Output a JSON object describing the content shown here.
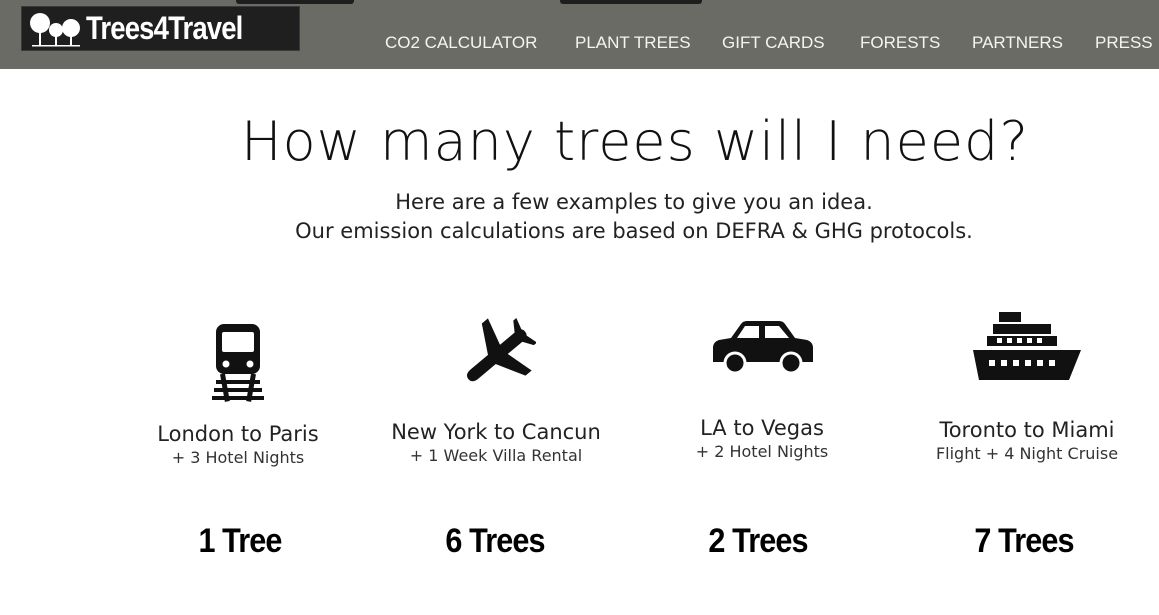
{
  "header": {
    "logo_text": "Trees4Travel",
    "nav": [
      {
        "label": "CO2 CALCULATOR"
      },
      {
        "label": "PLANT TREES"
      },
      {
        "label": "GIFT CARDS"
      },
      {
        "label": "FORESTS"
      },
      {
        "label": "PARTNERS"
      },
      {
        "label": "PRESS"
      }
    ],
    "colors": {
      "bar": "#6b6b66",
      "logo_bg": "#1f1f1f",
      "nav_text": "#f4f4f4"
    }
  },
  "main": {
    "title": "How many trees will I need?",
    "subtitle_line1": "Here are a few examples to give you an idea.",
    "subtitle_line2": "Our emission calculations are based on DEFRA & GHG protocols.",
    "examples": [
      {
        "icon": "train-icon",
        "route": "London to Paris",
        "extra": "+ 3 Hotel Nights",
        "trees": "1 Tree"
      },
      {
        "icon": "airplane-icon",
        "route": "New York to Cancun",
        "extra": "+ 1 Week Villa Rental",
        "trees": "6 Trees"
      },
      {
        "icon": "car-icon",
        "route": "LA to Vegas",
        "extra": "+ 2 Hotel Nights",
        "trees": "2 Trees"
      },
      {
        "icon": "cruise-ship-icon",
        "route": "Toronto to Miami",
        "extra": "Flight + 4 Night Cruise",
        "trees": "7 Trees"
      }
    ]
  }
}
